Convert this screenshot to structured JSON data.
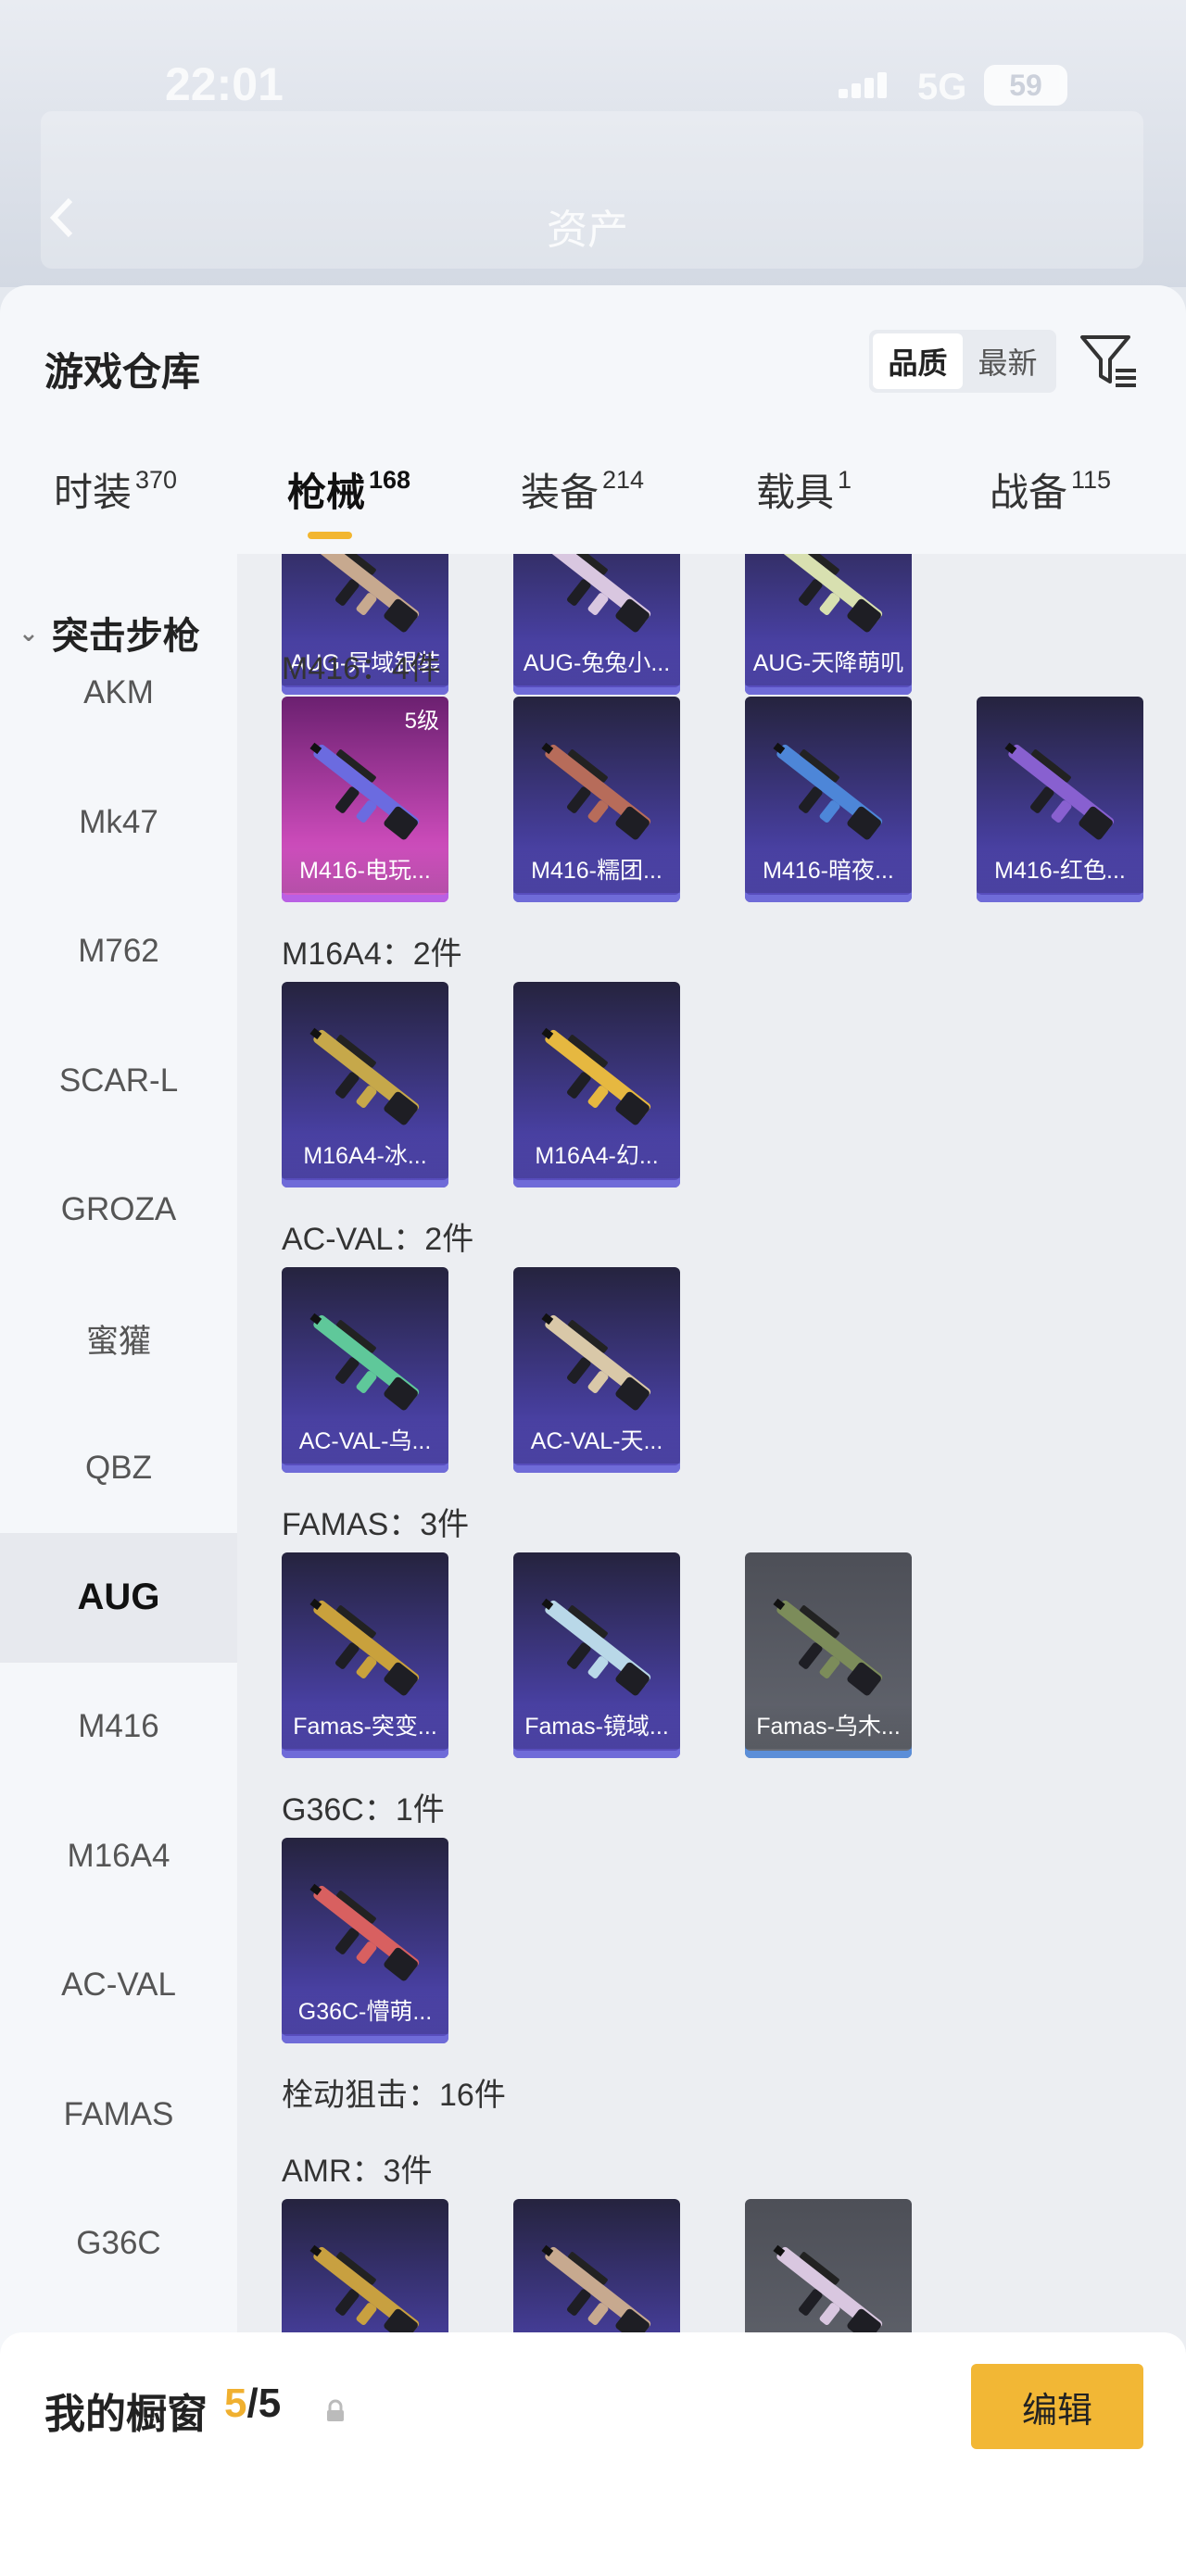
{
  "status_bar": {
    "time": "22:01",
    "network": "5G",
    "battery": "59"
  },
  "background_header": {
    "title": "资产"
  },
  "sheet": {
    "title": "游戏仓库",
    "sort_options": [
      "品质",
      "最新"
    ],
    "tabs": [
      {
        "label": "时装",
        "count": "370"
      },
      {
        "label": "枪械",
        "count": "168"
      },
      {
        "label": "装备",
        "count": "214"
      },
      {
        "label": "载具",
        "count": "1"
      },
      {
        "label": "战备",
        "count": "115"
      }
    ],
    "category": "突击步枪",
    "nav_items": [
      "AKM",
      "Mk47",
      "M762",
      "SCAR-L",
      "GROZA",
      "蜜獾",
      "QBZ",
      "AUG",
      "M416",
      "M16A4",
      "AC-VAL",
      "FAMAS",
      "G36C"
    ],
    "selected_nav": "AUG"
  },
  "groups": [
    {
      "header": "",
      "items": [
        {
          "label": "AUG-异域银装",
          "style": "purple"
        },
        {
          "label": "AUG-兔兔小...",
          "style": "purple"
        },
        {
          "label": "AUG-天降萌叽",
          "style": "purple"
        }
      ]
    },
    {
      "header": "M416：4件",
      "items": [
        {
          "label": "M416-电玩...",
          "style": "pink",
          "level": "5级"
        },
        {
          "label": "M416-糯团...",
          "style": "purple"
        },
        {
          "label": "M416-暗夜...",
          "style": "purple"
        },
        {
          "label": "M416-红色...",
          "style": "purple"
        }
      ]
    },
    {
      "header": "M16A4：2件",
      "items": [
        {
          "label": "M16A4-冰...",
          "style": "purple"
        },
        {
          "label": "M16A4-幻...",
          "style": "purple"
        }
      ]
    },
    {
      "header": "AC-VAL：2件",
      "items": [
        {
          "label": "AC-VAL-乌...",
          "style": "purple"
        },
        {
          "label": "AC-VAL-天...",
          "style": "purple"
        }
      ]
    },
    {
      "header": "FAMAS：3件",
      "items": [
        {
          "label": "Famas-突变...",
          "style": "purple"
        },
        {
          "label": "Famas-镜域...",
          "style": "purple"
        },
        {
          "label": "Famas-乌木...",
          "style": "grey"
        }
      ]
    },
    {
      "header": "G36C：1件",
      "items": [
        {
          "label": "G36C-懵萌...",
          "style": "purple"
        }
      ]
    },
    {
      "header": "栓动狙击：16件",
      "items": []
    },
    {
      "header": "AMR：3件",
      "items": [
        {
          "label": "",
          "style": "purple"
        },
        {
          "label": "",
          "style": "purple"
        },
        {
          "label": "",
          "style": "grey"
        }
      ]
    }
  ],
  "gun_colors": [
    "#c7a98f",
    "#d9c7e0",
    "#d8e0b0",
    "#6b6be0",
    "#b76c5a",
    "#4d86d8",
    "#8860d0",
    "#c6a84a",
    "#e6b840",
    "#5fc89a",
    "#d9c8a8",
    "#c9a13c",
    "#b9d8e8",
    "#7c8c5a",
    "#d86060",
    "#c8a040"
  ],
  "window": {
    "label": "我的橱窗",
    "current": "5",
    "total": "/5",
    "edit_label": "编辑"
  }
}
